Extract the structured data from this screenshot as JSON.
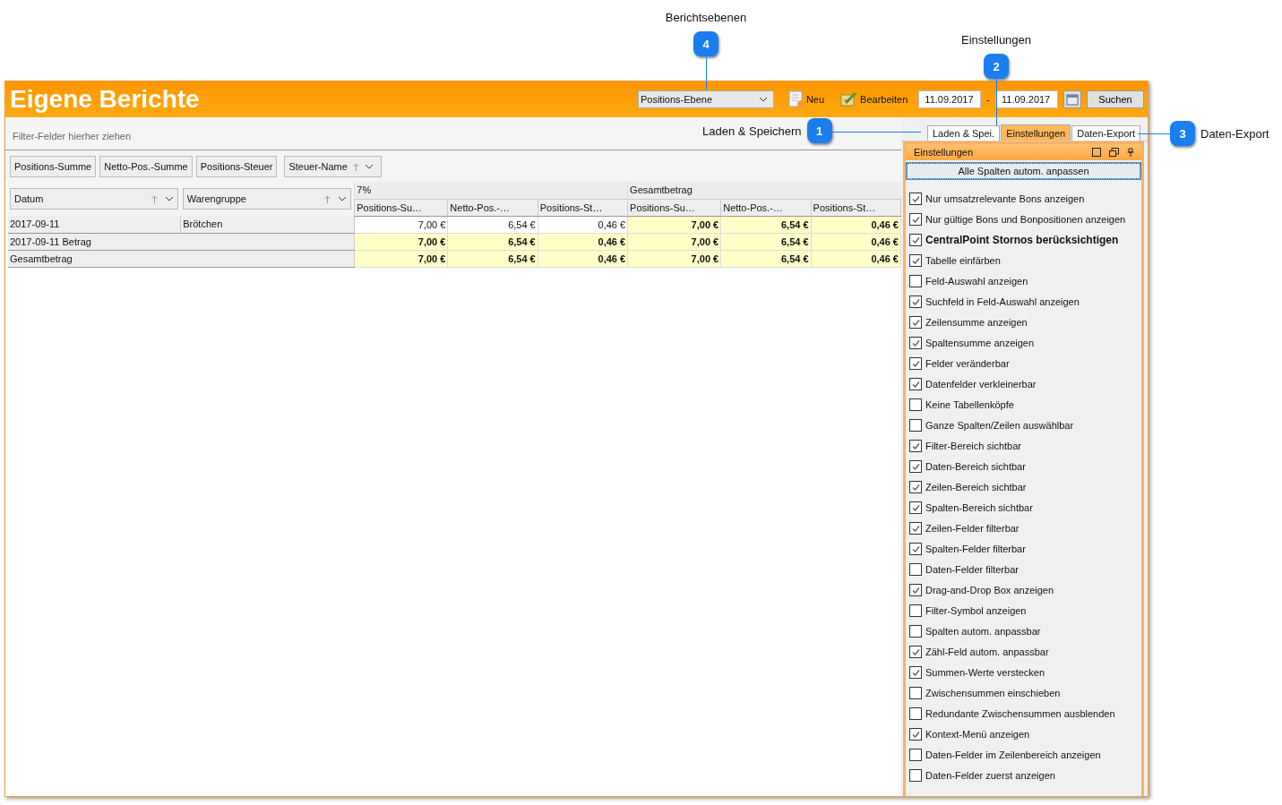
{
  "window": {
    "title": "Eigene Berichte"
  },
  "toolbar": {
    "level_select": "Positions-Ebene",
    "new_button": "Neu",
    "edit_button": "Bearbeiten",
    "date_from": "11.09.2017",
    "date_separator": "-",
    "date_to": "11.09.2017",
    "search_button": "Suchen"
  },
  "pivot": {
    "filter_placeholder": "Filter-Felder hierher ziehen",
    "data_fields": [
      "Positions-Summe",
      "Netto-Pos.-Summe",
      "Positions-Steuer"
    ],
    "column_field": "Steuer-Name",
    "row_fields": [
      "Datum",
      "Warengruppe"
    ],
    "column_groups": [
      "7%",
      "Gesamtbetrag"
    ],
    "columns": [
      "Positions-Su…",
      "Netto-Pos.-…",
      "Positions-St…",
      "Positions-Su…",
      "Netto-Pos.-…",
      "Positions-St…"
    ],
    "rows": [
      {
        "kind": "detail",
        "labels": [
          "2017-09-11",
          "Brötchen"
        ],
        "cells": [
          {
            "value": "7,00 €",
            "total": false
          },
          {
            "value": "6,54 €",
            "total": false
          },
          {
            "value": "0,46 €",
            "total": false
          },
          {
            "value": "7,00 €",
            "total": true
          },
          {
            "value": "6,54 €",
            "total": true
          },
          {
            "value": "0,46 €",
            "total": true
          }
        ]
      },
      {
        "kind": "total",
        "labels": [
          "2017-09-11 Betrag"
        ],
        "cells": [
          {
            "value": "7,00 €",
            "total": true
          },
          {
            "value": "6,54 €",
            "total": true
          },
          {
            "value": "0,46 €",
            "total": true
          },
          {
            "value": "7,00 €",
            "total": true
          },
          {
            "value": "6,54 €",
            "total": true
          },
          {
            "value": "0,46 €",
            "total": true
          }
        ]
      },
      {
        "kind": "total",
        "labels": [
          "Gesamtbetrag"
        ],
        "cells": [
          {
            "value": "7,00 €",
            "total": true
          },
          {
            "value": "6,54 €",
            "total": true
          },
          {
            "value": "0,46 €",
            "total": true
          },
          {
            "value": "7,00 €",
            "total": true
          },
          {
            "value": "6,54 €",
            "total": true
          },
          {
            "value": "0,46 €",
            "total": true
          }
        ]
      }
    ]
  },
  "tabs": [
    {
      "label": "Laden & Spei.",
      "selected": false
    },
    {
      "label": "Einstellungen",
      "selected": true
    },
    {
      "label": "Daten-Export",
      "selected": false
    }
  ],
  "settings": {
    "title": "Einstellungen",
    "fit_button": "Alle Spalten autom. anpassen",
    "options": [
      {
        "label": "Nur umsatzrelevante Bons anzeigen",
        "checked": true
      },
      {
        "label": "Nur gültige Bons und Bonpositionen anzeigen",
        "checked": true
      },
      {
        "label": "CentralPoint Stornos berücksichtigen",
        "checked": true,
        "bold": true
      },
      {
        "label": "Tabelle einfärben",
        "checked": true
      },
      {
        "label": "Feld-Auswahl anzeigen",
        "checked": false
      },
      {
        "label": "Suchfeld in Feld-Auswahl anzeigen",
        "checked": true
      },
      {
        "label": "Zeilensumme anzeigen",
        "checked": true
      },
      {
        "label": "Spaltensumme anzeigen",
        "checked": true
      },
      {
        "label": "Felder veränderbar",
        "checked": true
      },
      {
        "label": "Datenfelder verkleinerbar",
        "checked": true
      },
      {
        "label": "Keine Tabellenköpfe",
        "checked": false
      },
      {
        "label": "Ganze Spalten/Zeilen auswählbar",
        "checked": false
      },
      {
        "label": "Filter-Bereich sichtbar",
        "checked": true
      },
      {
        "label": "Daten-Bereich sichtbar",
        "checked": true
      },
      {
        "label": "Zeilen-Bereich sichtbar",
        "checked": true
      },
      {
        "label": "Spalten-Bereich sichtbar",
        "checked": true
      },
      {
        "label": "Zeilen-Felder filterbar",
        "checked": true
      },
      {
        "label": "Spalten-Felder filterbar",
        "checked": true
      },
      {
        "label": "Daten-Felder filterbar",
        "checked": false
      },
      {
        "label": "Drag-and-Drop Box anzeigen",
        "checked": true
      },
      {
        "label": "Filter-Symbol anzeigen",
        "checked": false
      },
      {
        "label": "Spalten autom. anpassbar",
        "checked": false
      },
      {
        "label": "Zähl-Feld autom. anpassbar",
        "checked": true
      },
      {
        "label": "Summen-Werte verstecken",
        "checked": true
      },
      {
        "label": "Zwischensummen einschieben",
        "checked": false
      },
      {
        "label": "Redundante Zwischensummen ausblenden",
        "checked": false
      },
      {
        "label": "Kontext-Menü anzeigen",
        "checked": true
      },
      {
        "label": "Daten-Felder im Zeilenbereich anzeigen",
        "checked": false
      },
      {
        "label": "Daten-Felder zuerst anzeigen",
        "checked": false
      }
    ]
  },
  "callouts": [
    {
      "number": "4",
      "label": "Berichtsebenen"
    },
    {
      "number": "2",
      "label": "Einstellungen"
    },
    {
      "number": "1",
      "label": "Laden & Speichern"
    },
    {
      "number": "3",
      "label": "Daten-Export"
    }
  ]
}
